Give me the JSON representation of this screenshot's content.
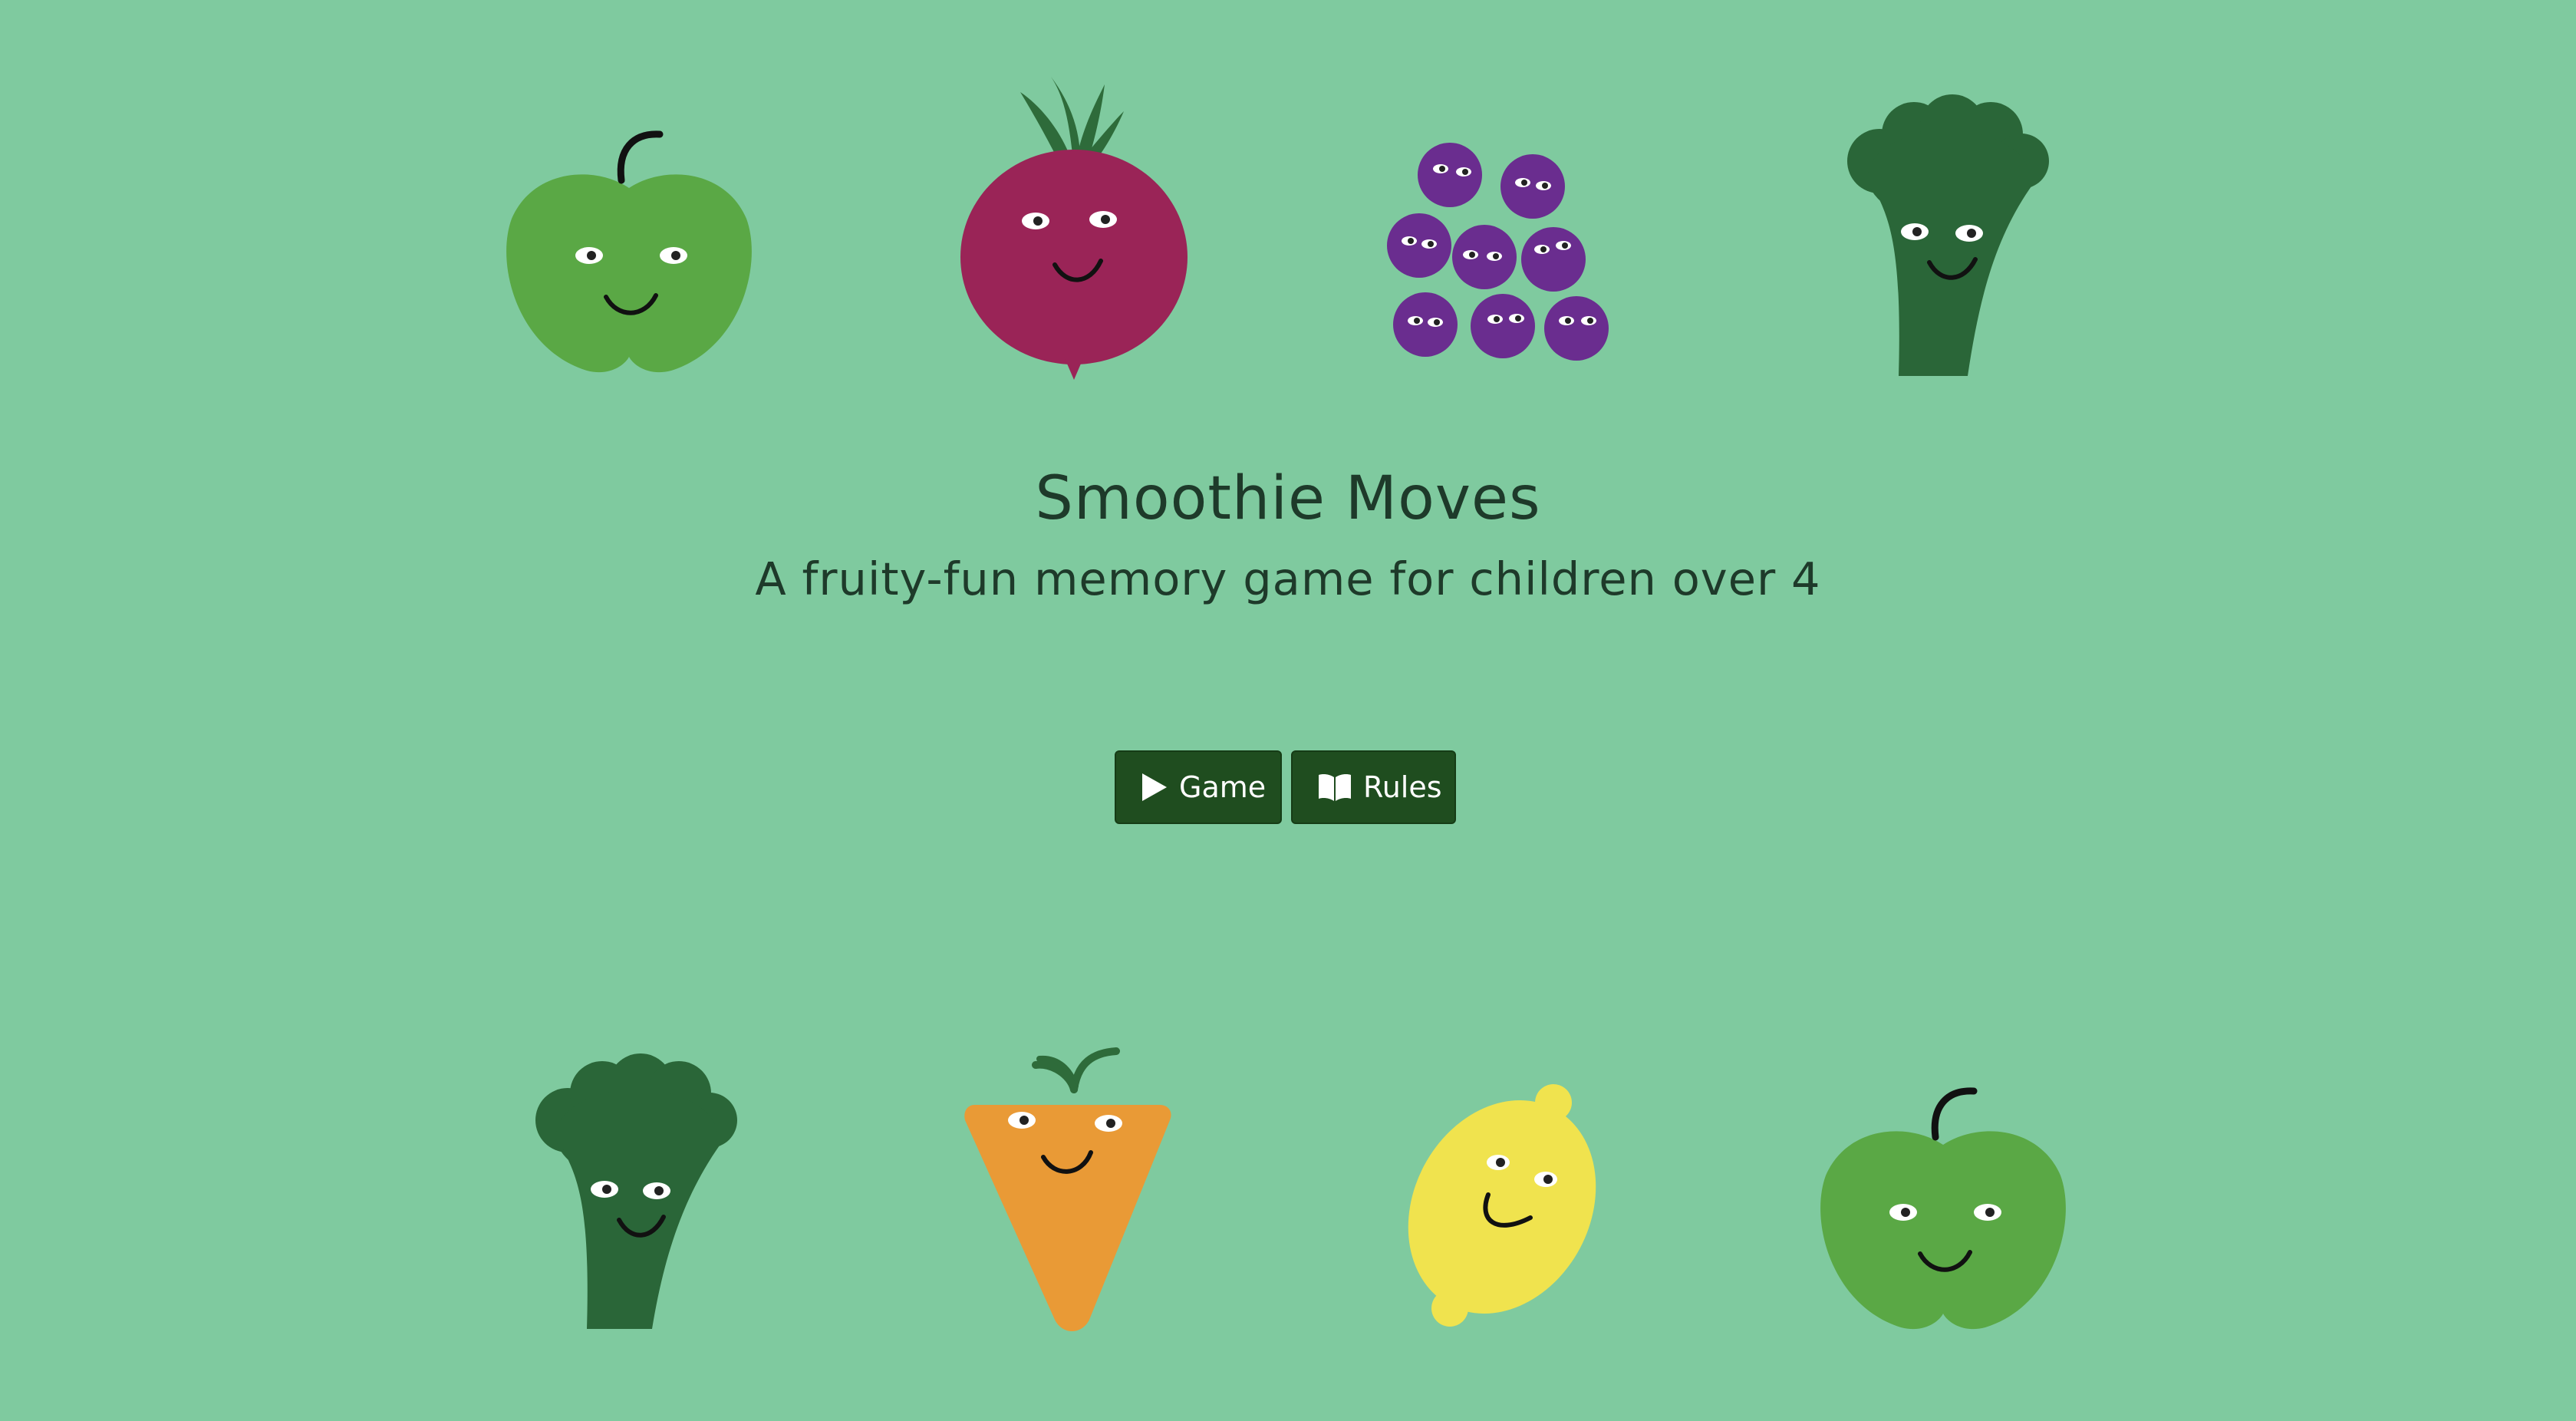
{
  "header": {
    "title": "Smoothie Moves",
    "subtitle": "A fruity-fun memory game for children over 4"
  },
  "menu": {
    "game_label": "Game",
    "rules_label": "Rules",
    "game_icon": "play-icon",
    "rules_icon": "book-open-icon"
  },
  "decorations": {
    "top_row": [
      "apple",
      "beetroot",
      "grapes",
      "broccoli"
    ],
    "bottom_row": [
      "broccoli",
      "carrot",
      "lemon",
      "apple"
    ]
  },
  "colors": {
    "background": "#7fca9f",
    "button": "#1f4d1f",
    "text": "#1e3a2a",
    "apple": "#5aa845",
    "beetroot": "#9a2457",
    "grape": "#6a2d8f",
    "broccoli": "#2a6638",
    "carrot": "#e99a36",
    "lemon": "#f0e34e"
  }
}
